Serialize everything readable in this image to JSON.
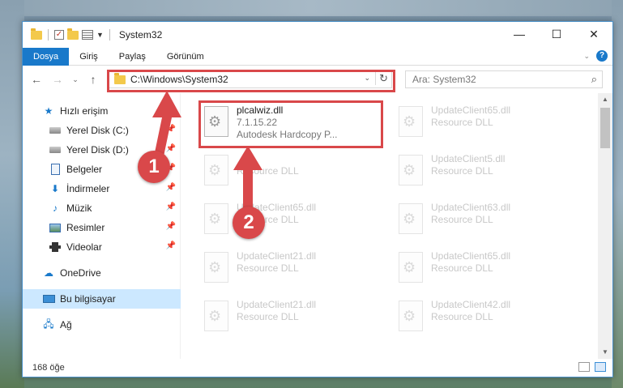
{
  "window": {
    "title": "System32",
    "controls": {
      "minimize": "—",
      "maximize": "☐",
      "close": "✕"
    }
  },
  "ribbon": {
    "tabs": [
      {
        "label": "Dosya",
        "active": true
      },
      {
        "label": "Giriş"
      },
      {
        "label": "Paylaş"
      },
      {
        "label": "Görünüm"
      }
    ]
  },
  "address": {
    "path": "C:\\Windows\\System32",
    "search_placeholder": "Ara: System32"
  },
  "nav": {
    "items": [
      {
        "label": "Hızlı erişim",
        "icon": "star-icon"
      },
      {
        "label": "Yerel Disk (C:)",
        "icon": "drive-icon",
        "pinned": true
      },
      {
        "label": "Yerel Disk (D:)",
        "icon": "drive-icon",
        "pinned": true
      },
      {
        "label": "Belgeler",
        "icon": "document-icon",
        "pinned": true
      },
      {
        "label": "İndirmeler",
        "icon": "download-icon",
        "pinned": true
      },
      {
        "label": "Müzik",
        "icon": "music-icon",
        "pinned": true
      },
      {
        "label": "Resimler",
        "icon": "pictures-icon",
        "pinned": true
      },
      {
        "label": "Videolar",
        "icon": "videos-icon",
        "pinned": true
      },
      {
        "label": "OneDrive",
        "icon": "cloud-icon"
      },
      {
        "label": "Bu bilgisayar",
        "icon": "computer-icon",
        "selected": true
      },
      {
        "label": "Ağ",
        "icon": "network-icon"
      }
    ]
  },
  "files": [
    {
      "name": "plcalwiz.dll",
      "line2": "7.1.15.22",
      "line3": "Autodesk Hardcopy P...",
      "faded": false
    },
    {
      "name": "UpdateClient65.dll",
      "line2": "Resource DLL",
      "faded": true
    },
    {
      "name": "",
      "line2": "Resource DLL",
      "faded": true
    },
    {
      "name": "UpdateClient5.dll",
      "line2": "Resource DLL",
      "faded": true
    },
    {
      "name": "UpdateClient65.dll",
      "line2": "Resource DLL",
      "faded": true
    },
    {
      "name": "UpdateClient63.dll",
      "line2": "Resource DLL",
      "faded": true
    },
    {
      "name": "UpdateClient21.dll",
      "line2": "Resource DLL",
      "faded": true
    },
    {
      "name": "UpdateClient65.dll",
      "line2": "Resource DLL",
      "faded": true
    },
    {
      "name": "UpdateClient21.dll",
      "line2": "Resource DLL",
      "faded": true
    },
    {
      "name": "UpdateClient42.dll",
      "line2": "Resource DLL",
      "faded": true
    }
  ],
  "status": {
    "item_count": "168 öğe"
  },
  "annotations": {
    "badge1": "1",
    "badge2": "2",
    "highlight_color": "#d9484a"
  },
  "colors": {
    "accent": "#1979ca",
    "selection": "#cce8ff"
  }
}
